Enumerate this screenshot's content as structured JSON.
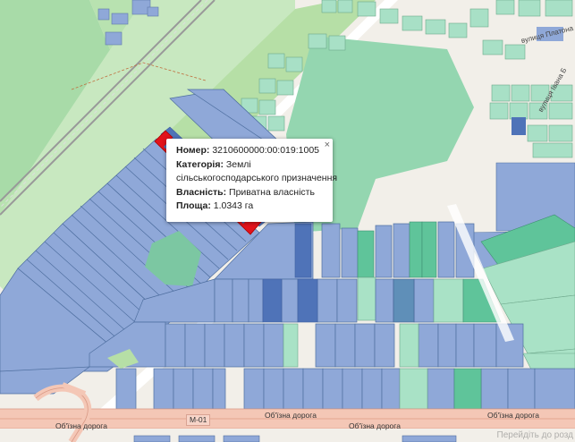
{
  "popup": {
    "number_label": "Номер:",
    "number_value": "3210600000:00:019:1005",
    "category_label": "Категорія:",
    "category_value_line1": "Землі",
    "category_value_line2": "сільськогосподарського призначення",
    "ownership_label": "Власність:",
    "ownership_value": "Приватна власність",
    "area_label": "Площа:",
    "area_value": "1.0343 га",
    "close_glyph": "×"
  },
  "labels": {
    "bypass_road_1": "Об'їзна дорога",
    "bypass_road_2": "Об'їзна дорога",
    "bypass_road_3": "Об'їзна дорога",
    "bypass_road_4": "Об'їзна дорога",
    "highway_shield": "М-01",
    "street_platonova": "вулиця Платона",
    "street_ivana": "вулиця Івана Б",
    "watermark": "Перейдіть до розд"
  },
  "colors": {
    "parcel_blue": "#8fa8d8",
    "parcel_dark_blue": "#4f73b8",
    "parcel_teal": "#5fc49a",
    "parcel_light_green": "#a9e2c6",
    "forest_green": "#94d6b0",
    "selected_red": "#e3121a",
    "road_orange": "#f4c7b6"
  }
}
